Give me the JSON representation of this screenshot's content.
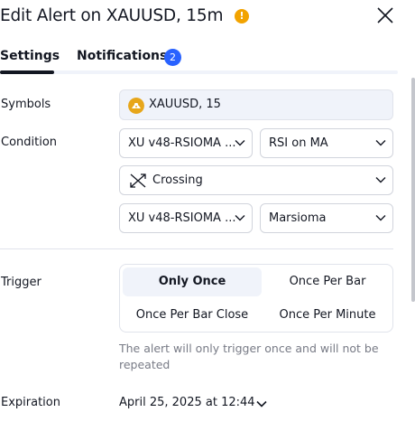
{
  "dialog": {
    "title": "Edit Alert on XAUUSD, 15m",
    "warning_icon": "exclamation-icon",
    "close_icon": "close-icon"
  },
  "tabs": [
    {
      "label": "Settings",
      "active": true
    },
    {
      "label": "Notifications",
      "badge": "2"
    }
  ],
  "symbols": {
    "label": "Symbols",
    "value": "XAUUSD, 15"
  },
  "condition": {
    "label": "Condition",
    "source1": "XU v48-RSIOMA ...",
    "plot1": "RSI on MA",
    "operator": "Crossing",
    "operator_icon": "crossing-icon",
    "source2": "XU v48-RSIOMA ...",
    "plot2": "Marsioma"
  },
  "trigger": {
    "label": "Trigger",
    "options": [
      "Only Once",
      "Once Per Bar",
      "Once Per Bar Close",
      "Once Per Minute"
    ],
    "selected": "Only Once",
    "hint": "The alert will only trigger once and will not be repeated"
  },
  "expiration": {
    "label": "Expiration",
    "value": "April 25, 2025 at 12:44"
  },
  "colors": {
    "accent": "#2962ff",
    "warning": "#f2a300",
    "text": "#131722",
    "muted": "#787b86",
    "border": "#d1d4dc",
    "selected_bg": "#f0f3fa"
  }
}
